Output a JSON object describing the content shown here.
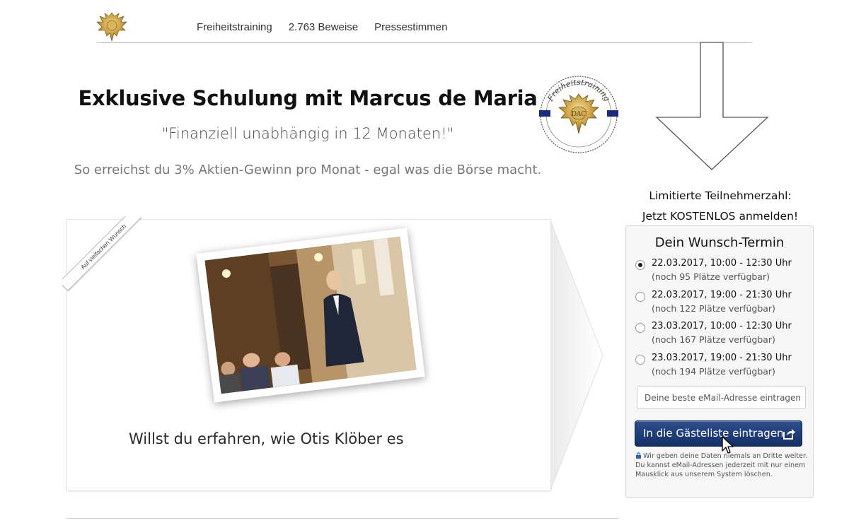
{
  "header": {
    "nav": [
      "Freiheitstraining",
      "2.763 Beweise",
      "Pressestimmen"
    ],
    "logo_icon": "eagle-crest-icon"
  },
  "hero": {
    "title": "Exklusive Schulung mit Marcus de Maria",
    "quote": "\"Finanziell unabhängig in 12 Monaten!\"",
    "subtitle": "So erreichst du 3% Aktien-Gewinn pro Monat - egal was die Börse macht.",
    "seal_icon": "freiheitstraining-seal-icon",
    "seal_text": "Freiheitstraining"
  },
  "video": {
    "ribbon": "Auf vielfachen Wunsch",
    "text": "Willst du erfahren, wie Otis Klöber es"
  },
  "signup": {
    "headline_1": "Limitierte Teilnehmerzahl:",
    "headline_2": "Jetzt KOSTENLOS anmelden!",
    "title": "Dein Wunsch-Termin",
    "options": [
      {
        "date": "22.03.2017, 10:00 - 12:30 Uhr",
        "seats": "(noch 95 Plätze verfügbar)",
        "selected": true
      },
      {
        "date": "22.03.2017, 19:00 - 21:30 Uhr",
        "seats": "(noch 122 Plätze verfügbar)",
        "selected": false
      },
      {
        "date": "23.03.2017, 10:00 - 12:30 Uhr",
        "seats": "(noch 167 Plätze verfügbar)",
        "selected": false
      },
      {
        "date": "23.03.2017, 19:00 - 21:30 Uhr",
        "seats": "(noch 194 Plätze verfügbar)",
        "selected": false
      }
    ],
    "email_placeholder": "Deine beste eMail-Adresse eintragen",
    "submit_label": "In die Gästeliste eintragen",
    "privacy": "Wir geben deine Daten niemals an Dritte weiter. Du kannst eMail-Adressen jederzeit mit nur einem Mausklick aus unserem System löschen.",
    "colors": {
      "button": "#1f3f7a",
      "panel": "#f6f6f6"
    }
  }
}
